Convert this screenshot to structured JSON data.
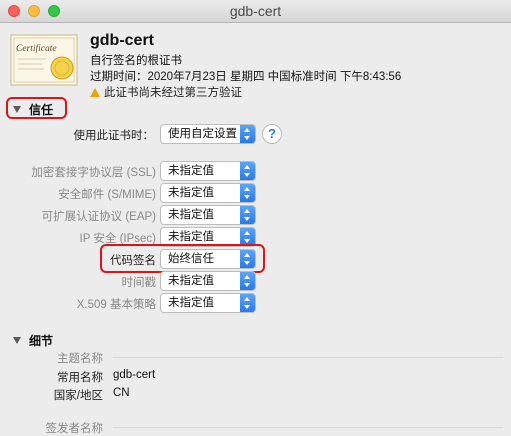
{
  "window": {
    "title": "gdb-cert"
  },
  "certificate": {
    "name": "gdb-cert",
    "type": "自行签名的根证书",
    "expiry": "过期时间：2020年7月23日 星期四 中国标准时间 下午8:43:56",
    "warning": "此证书尚未经过第三方验证",
    "icon_text": "Certificate"
  },
  "trust": {
    "section_title": "信任",
    "when_using_label": "使用此证书时：",
    "when_using_value": "使用自定设置",
    "help_label": "?",
    "rows": [
      {
        "label": "加密套接字协议层 (SSL)",
        "value": "未指定值"
      },
      {
        "label": "安全邮件 (S/MIME)",
        "value": "未指定值"
      },
      {
        "label": "可扩展认证协议 (EAP)",
        "value": "未指定值"
      },
      {
        "label": "IP 安全 (IPsec)",
        "value": "未指定值"
      },
      {
        "label": "代码签名",
        "value": "始终信任"
      },
      {
        "label": "时间戳",
        "value": "未指定值"
      },
      {
        "label": "X.509 基本策略",
        "value": "未指定值"
      }
    ]
  },
  "details": {
    "section_title": "细节",
    "subject_name_label": "主题名称",
    "common_name_label": "常用名称",
    "common_name_value": "gdb-cert",
    "country_label": "国家/地区",
    "country_value": "CN",
    "issuer_name_label": "签发者名称"
  },
  "colors": {
    "accent": "#2a79e6",
    "highlight": "#d9161c"
  }
}
